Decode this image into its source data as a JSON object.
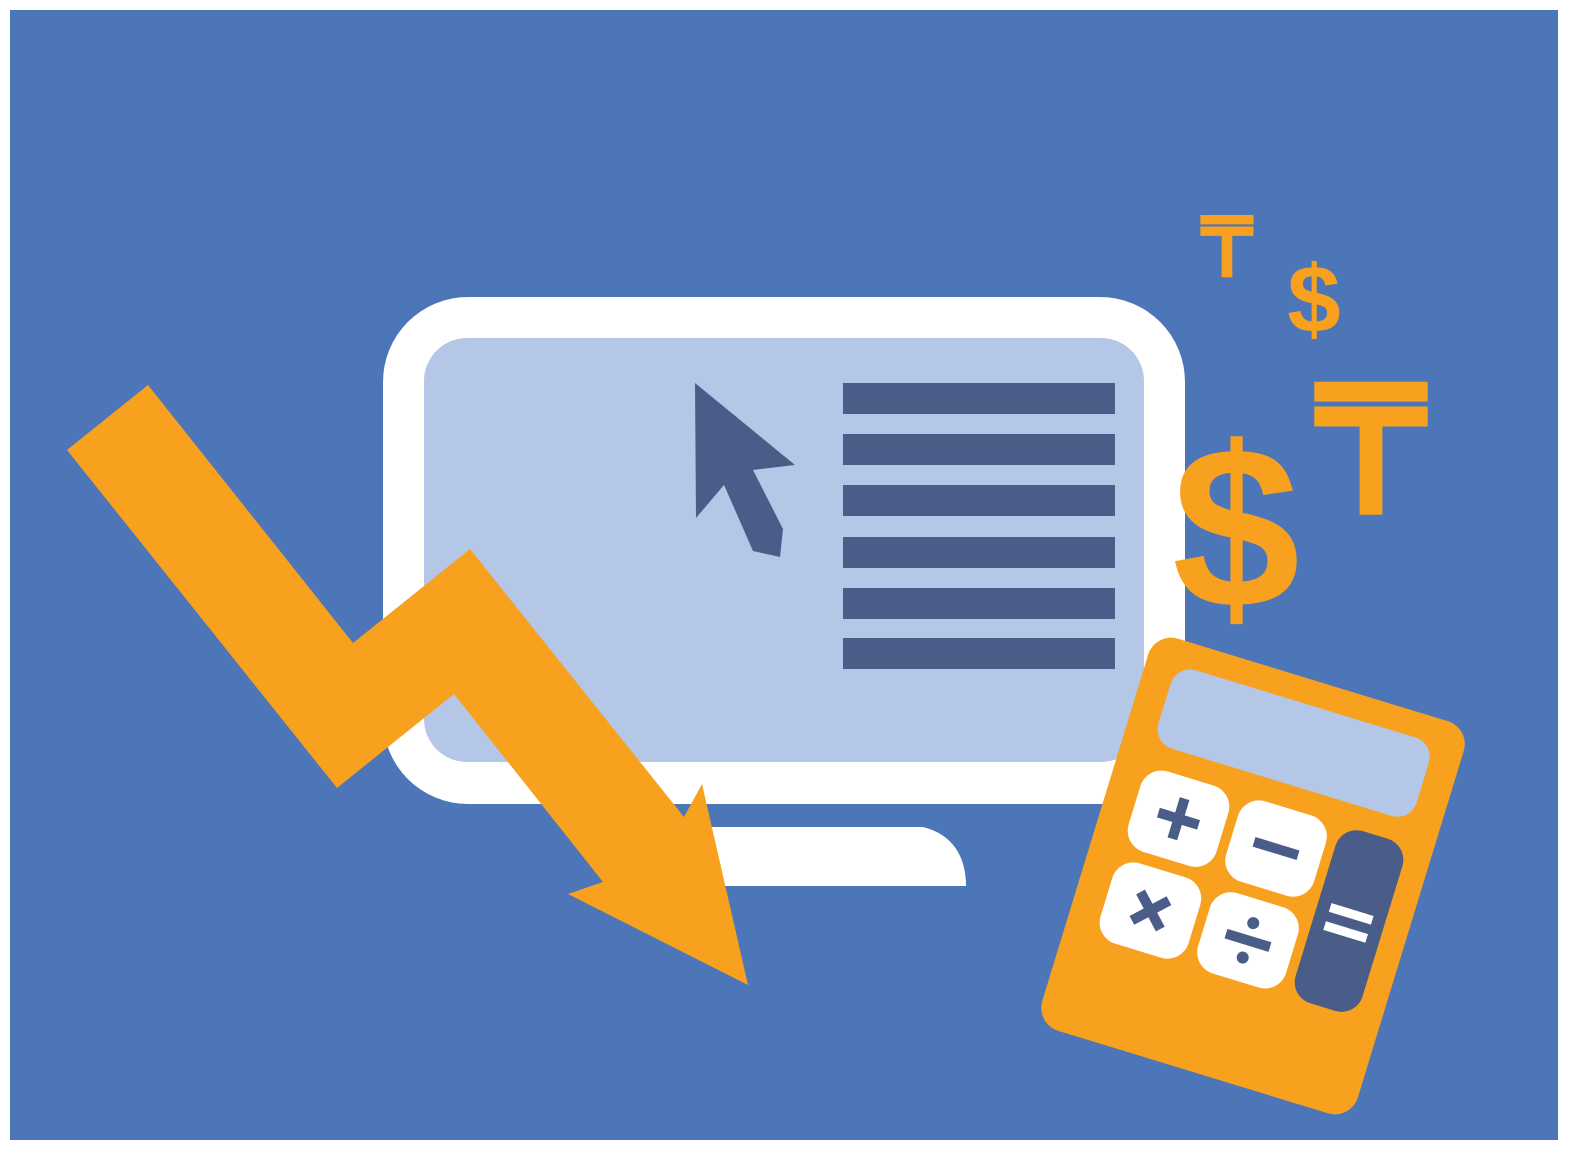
{
  "palette": {
    "canvas": "#ffffff",
    "background": "#4c76b8",
    "frame": "#ffffff",
    "screen": "#b5c7e7",
    "ink": "#4a5d88",
    "accent": "#f7a11e",
    "key": "#ffffff"
  },
  "currency_symbols": {
    "dollar_large": "$",
    "dollar_small": "$",
    "tenge_large": "₸",
    "tenge_small": "₸"
  },
  "icons": {
    "monitor": "monitor-icon",
    "cursor": "mouse-pointer-icon",
    "trend": "downward-trend-arrow-icon",
    "calculator": "calculator-icon",
    "plus_key": "plus-icon",
    "minus_key": "minus-icon",
    "multiply_key": "multiply-icon",
    "divide_key": "divide-icon",
    "equals_key": "equals-icon"
  },
  "screen_list": {
    "line_count": 6
  }
}
